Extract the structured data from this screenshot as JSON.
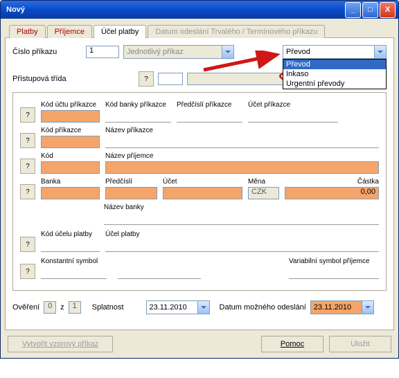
{
  "window": {
    "title": "Nový"
  },
  "tabs": {
    "platby": "Platby",
    "prijemce": "Příjemce",
    "ucel": "Účel platby",
    "datum": "Datum odeslání Trvalého / Termínového příkazu"
  },
  "form": {
    "cislo_prikazu_label": "Číslo příkazu",
    "cislo_prikazu_value": "1",
    "platba_typ_combo": "Jednotlivý příkaz",
    "prevod_combo": "Převod",
    "prevod_options": {
      "prevod": "Převod",
      "inkaso": "Inkaso",
      "urgentni": "Urgentní převody"
    },
    "pristup_label": "Přístupová třída"
  },
  "fields": {
    "kod_uctu_prikazce": "Kód účtu příkazce",
    "kod_banky_prikazce": "Kód banky příkazce",
    "predcisli_prikazce": "Předčíslí příkazce",
    "ucet_prikazce": "Účet příkazce",
    "kod_prikazce": "Kód příkazce",
    "nazev_prikazce": "Název příkazce",
    "kod": "Kód",
    "nazev_prijemce": "Název příjemce",
    "banka": "Banka",
    "predcisli": "Předčíslí",
    "ucet": "Účet",
    "mena": "Měna",
    "mena_value": "CZK",
    "castka": "Částka",
    "castka_value": "0,00",
    "nazev_banky": "Název banky",
    "kod_ucelu_platby": "Kód účelu platby",
    "ucel_platby": "Účel platby",
    "konst_symbol": "Konstantní symbol",
    "var_symbol_prijemce": "Variabilní symbol příjemce"
  },
  "bottom": {
    "overeni_label": "Ověření",
    "overeni_1": "0",
    "overeni_z": "z",
    "overeni_2": "1",
    "splatnost_label": "Splatnost",
    "splatnost_value": "23.11.2010",
    "mozne_odeslani_label": "Datum možného odeslání",
    "mozne_odeslani_value": "23.11.2010"
  },
  "buttons": {
    "vzor": "Vytvořit vzorový příkaz",
    "pomoc": "Pomoc",
    "ulozit": "Uložit"
  },
  "q": "?"
}
